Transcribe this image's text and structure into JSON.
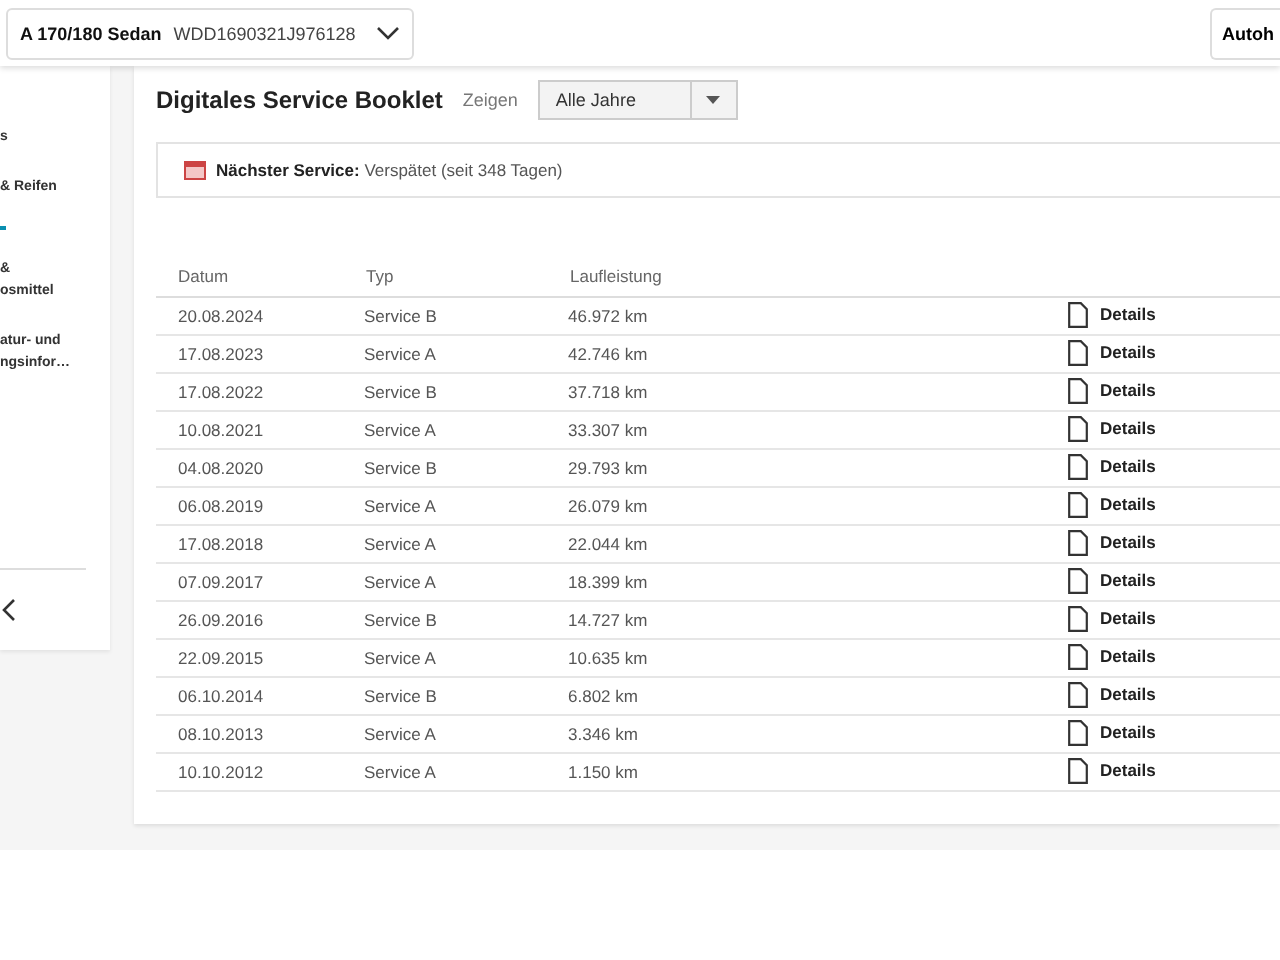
{
  "header": {
    "model": "A 170/180 Sedan",
    "vin": "WDD1690321J976128",
    "right_button": "Autoh"
  },
  "sidebar": {
    "items": [
      {
        "lines": [
          "s"
        ],
        "selected": false
      },
      {
        "lines": [
          "& Reifen"
        ],
        "selected": false
      },
      {
        "selected": true
      },
      {
        "lines": [
          "&",
          "osmittel"
        ],
        "selected": false
      },
      {
        "lines": [
          "atur- und",
          "ngsinfor…"
        ],
        "selected": false
      }
    ]
  },
  "page": {
    "title": "Digitales Service Booklet",
    "filter_label": "Zeigen",
    "filter_value": "Alle Jahre"
  },
  "notice": {
    "label": "Nächster Service:",
    "text": "Verspätet (seit 348 Tagen)"
  },
  "table": {
    "columns": [
      "Datum",
      "Typ",
      "Laufleistung"
    ],
    "rows": [
      {
        "date": "20.08.2024",
        "type": "Service B",
        "mileage": "46.972 km",
        "link": "Details"
      },
      {
        "date": "17.08.2023",
        "type": "Service A",
        "mileage": "42.746 km",
        "link": "Details"
      },
      {
        "date": "17.08.2022",
        "type": "Service B",
        "mileage": "37.718 km",
        "link": "Details"
      },
      {
        "date": "10.08.2021",
        "type": "Service A",
        "mileage": "33.307 km",
        "link": "Details"
      },
      {
        "date": "04.08.2020",
        "type": "Service B",
        "mileage": "29.793 km",
        "link": "Details"
      },
      {
        "date": "06.08.2019",
        "type": "Service A",
        "mileage": "26.079 km",
        "link": "Details"
      },
      {
        "date": "17.08.2018",
        "type": "Service A",
        "mileage": "22.044 km",
        "link": "Details"
      },
      {
        "date": "07.09.2017",
        "type": "Service A",
        "mileage": "18.399 km",
        "link": "Details"
      },
      {
        "date": "26.09.2016",
        "type": "Service B",
        "mileage": "14.727 km",
        "link": "Details"
      },
      {
        "date": "22.09.2015",
        "type": "Service A",
        "mileage": "10.635 km",
        "link": "Details"
      },
      {
        "date": "06.10.2014",
        "type": "Service B",
        "mileage": "6.802 km",
        "link": "Details"
      },
      {
        "date": "08.10.2013",
        "type": "Service A",
        "mileage": "3.346 km",
        "link": "Details"
      },
      {
        "date": "10.10.2012",
        "type": "Service A",
        "mileage": "1.150 km",
        "link": "Details"
      }
    ]
  }
}
